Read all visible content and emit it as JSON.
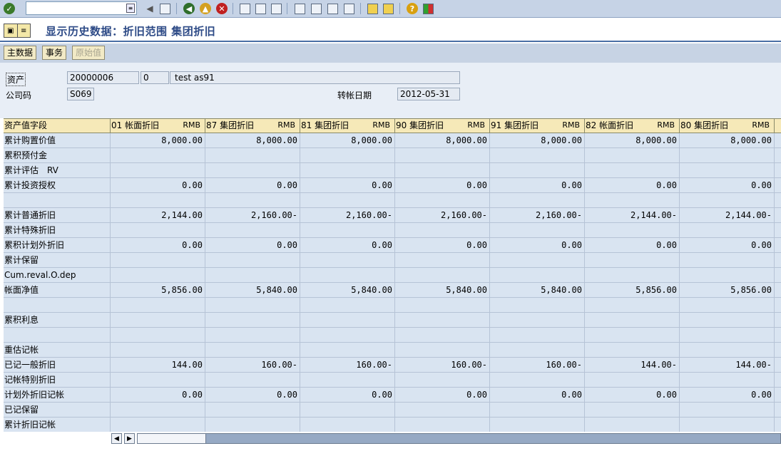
{
  "toolbar": {
    "command_value": "",
    "icons": [
      "enter-icon",
      "back-icon",
      "exit-icon",
      "cancel-icon",
      "print-icon",
      "find-icon",
      "find-next-icon",
      "first-page-icon",
      "prev-page-icon",
      "next-page-icon",
      "last-page-icon",
      "new-session-icon",
      "shortcut-icon",
      "help-icon",
      "layout-icon"
    ]
  },
  "title": "显示历史数据：折旧范围 集团折旧",
  "app_toolbar": {
    "master_data": "主数据",
    "transactions": "事务",
    "orig_value": "原始值"
  },
  "header": {
    "asset_label": "资产",
    "asset_number": "20000006",
    "asset_sub": "0",
    "asset_desc": "test as91",
    "company_label": "公司码",
    "company_code": "S069",
    "posting_date_label": "转帐日期",
    "posting_date": "2012-05-31"
  },
  "grid": {
    "first_col_header": "资产值字段",
    "currency": "RMB",
    "columns": [
      "01 帐面折旧",
      "87 集团折旧",
      "81 集团折旧",
      "90 集团折旧",
      "91 集团折旧",
      "82 帐面折旧",
      "80 集团折旧"
    ],
    "rows": [
      {
        "field": "累计购置价值",
        "values": [
          "8,000.00",
          "8,000.00",
          "8,000.00",
          "8,000.00",
          "8,000.00",
          "8,000.00",
          "8,000.00"
        ]
      },
      {
        "field": "累积预付金",
        "values": [
          "",
          "",
          "",
          "",
          "",
          "",
          ""
        ]
      },
      {
        "field": "累计评估　RV",
        "values": [
          "",
          "",
          "",
          "",
          "",
          "",
          ""
        ]
      },
      {
        "field": "累计投资授权",
        "values": [
          "0.00",
          "0.00",
          "0.00",
          "0.00",
          "0.00",
          "0.00",
          "0.00"
        ]
      },
      {
        "field": "",
        "values": [
          "",
          "",
          "",
          "",
          "",
          "",
          ""
        ]
      },
      {
        "field": "累计普通折旧",
        "values": [
          "2,144.00",
          "2,160.00-",
          "2,160.00-",
          "2,160.00-",
          "2,160.00-",
          "2,144.00-",
          "2,144.00-"
        ]
      },
      {
        "field": "累计特殊折旧",
        "values": [
          "",
          "",
          "",
          "",
          "",
          "",
          ""
        ]
      },
      {
        "field": "累积计划外折旧",
        "values": [
          "0.00",
          "0.00",
          "0.00",
          "0.00",
          "0.00",
          "0.00",
          "0.00"
        ]
      },
      {
        "field": "累计保留",
        "values": [
          "",
          "",
          "",
          "",
          "",
          "",
          ""
        ]
      },
      {
        "field": "Cum.reval.O.dep",
        "values": [
          "",
          "",
          "",
          "",
          "",
          "",
          ""
        ]
      },
      {
        "field": "帐面净值",
        "values": [
          "5,856.00",
          "5,840.00",
          "5,840.00",
          "5,840.00",
          "5,840.00",
          "5,856.00",
          "5,856.00"
        ]
      },
      {
        "field": "",
        "values": [
          "",
          "",
          "",
          "",
          "",
          "",
          ""
        ]
      },
      {
        "field": "累积利息",
        "values": [
          "",
          "",
          "",
          "",
          "",
          "",
          ""
        ]
      },
      {
        "field": "",
        "values": [
          "",
          "",
          "",
          "",
          "",
          "",
          ""
        ]
      },
      {
        "field": "重估记帐",
        "values": [
          "",
          "",
          "",
          "",
          "",
          "",
          ""
        ]
      },
      {
        "field": "已记一般折旧",
        "values": [
          "144.00",
          "160.00-",
          "160.00-",
          "160.00-",
          "160.00-",
          "144.00-",
          "144.00-"
        ]
      },
      {
        "field": "记帐特别折旧",
        "values": [
          "",
          "",
          "",
          "",
          "",
          "",
          ""
        ]
      },
      {
        "field": "计划外折旧记帐",
        "values": [
          "0.00",
          "0.00",
          "0.00",
          "0.00",
          "0.00",
          "0.00",
          "0.00"
        ]
      },
      {
        "field": "已记保留",
        "values": [
          "",
          "",
          "",
          "",
          "",
          "",
          ""
        ]
      },
      {
        "field": "累计折旧记帐",
        "values": [
          "",
          "",
          "",
          "",
          "",
          "",
          ""
        ]
      }
    ]
  }
}
